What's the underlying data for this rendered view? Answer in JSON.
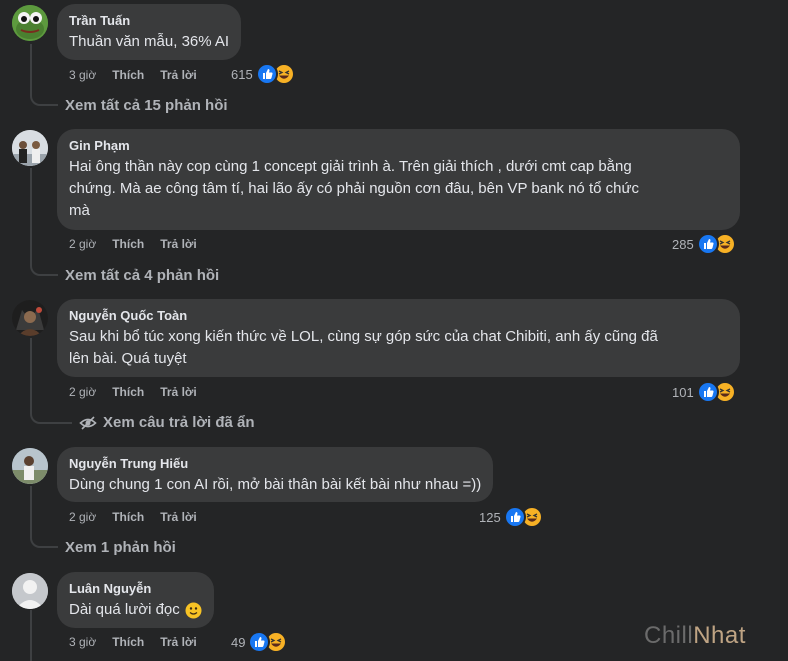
{
  "comments": [
    {
      "author": "Trần Tuấn",
      "text": [
        "Thuần văn mẫu, 36% AI"
      ],
      "time": "3 giờ",
      "like_label": "Thích",
      "reply_label": "Trả lời",
      "reaction_count": "615",
      "reactions": [
        "like-icon",
        "haha-icon"
      ],
      "view_replies": "Xem tất cả 15 phản hồi"
    },
    {
      "author": "Gin Phạm",
      "text": [
        "Hai ông thần này cop cùng 1 concept giải trình à. Trên giải thích , dưới cmt cap bằng",
        "chứng. Mà ae công tâm tí, hai lão ấy có phải nguồn cơn đâu, bên VP bank nó tổ chức",
        "mà"
      ],
      "time": "2 giờ",
      "like_label": "Thích",
      "reply_label": "Trả lời",
      "reaction_count": "285",
      "reactions": [
        "like-icon",
        "haha-icon"
      ],
      "view_replies": "Xem tất cả 4 phản hồi"
    },
    {
      "author": "Nguyễn Quốc Toàn",
      "text": [
        "Sau khi bổ túc xong kiến thức về LOL, cùng sự góp sức của chat Chibiti, anh ấy cũng đã",
        "lên bài. Quá tuyệt"
      ],
      "time": "2 giờ",
      "like_label": "Thích",
      "reply_label": "Trả lời",
      "reaction_count": "101",
      "reactions": [
        "like-icon",
        "haha-icon"
      ],
      "view_replies": "Xem câu trả lời đã ẩn"
    },
    {
      "author": "Nguyễn Trung Hiếu",
      "text": [
        "Dùng chung 1 con AI rồi, mở bài thân bài kết bài như nhau =))"
      ],
      "time": "2 giờ",
      "like_label": "Thích",
      "reply_label": "Trả lời",
      "reaction_count": "125",
      "reactions": [
        "like-icon",
        "haha-icon"
      ],
      "view_replies": "Xem 1 phản hồi"
    },
    {
      "author": "Luân Nguyễn",
      "text": [
        "Dài quá lười đọc"
      ],
      "text_emoji": "slightly-smiling-face-icon",
      "time": "3 giờ",
      "like_label": "Thích",
      "reply_label": "Trả lời",
      "reaction_count": "49",
      "reactions": [
        "like-icon",
        "haha-icon"
      ]
    }
  ],
  "hidden_replies_icon": "eye-slash-icon",
  "watermark": {
    "part1": "Chill",
    "part2": "Nhat"
  },
  "colors": {
    "background": "#242526",
    "bubble": "#3a3b3c",
    "text_primary": "#e4e6eb",
    "text_secondary": "#b0b3b8",
    "like_blue": "#1877f2",
    "haha_yellow": "#f7b125"
  }
}
